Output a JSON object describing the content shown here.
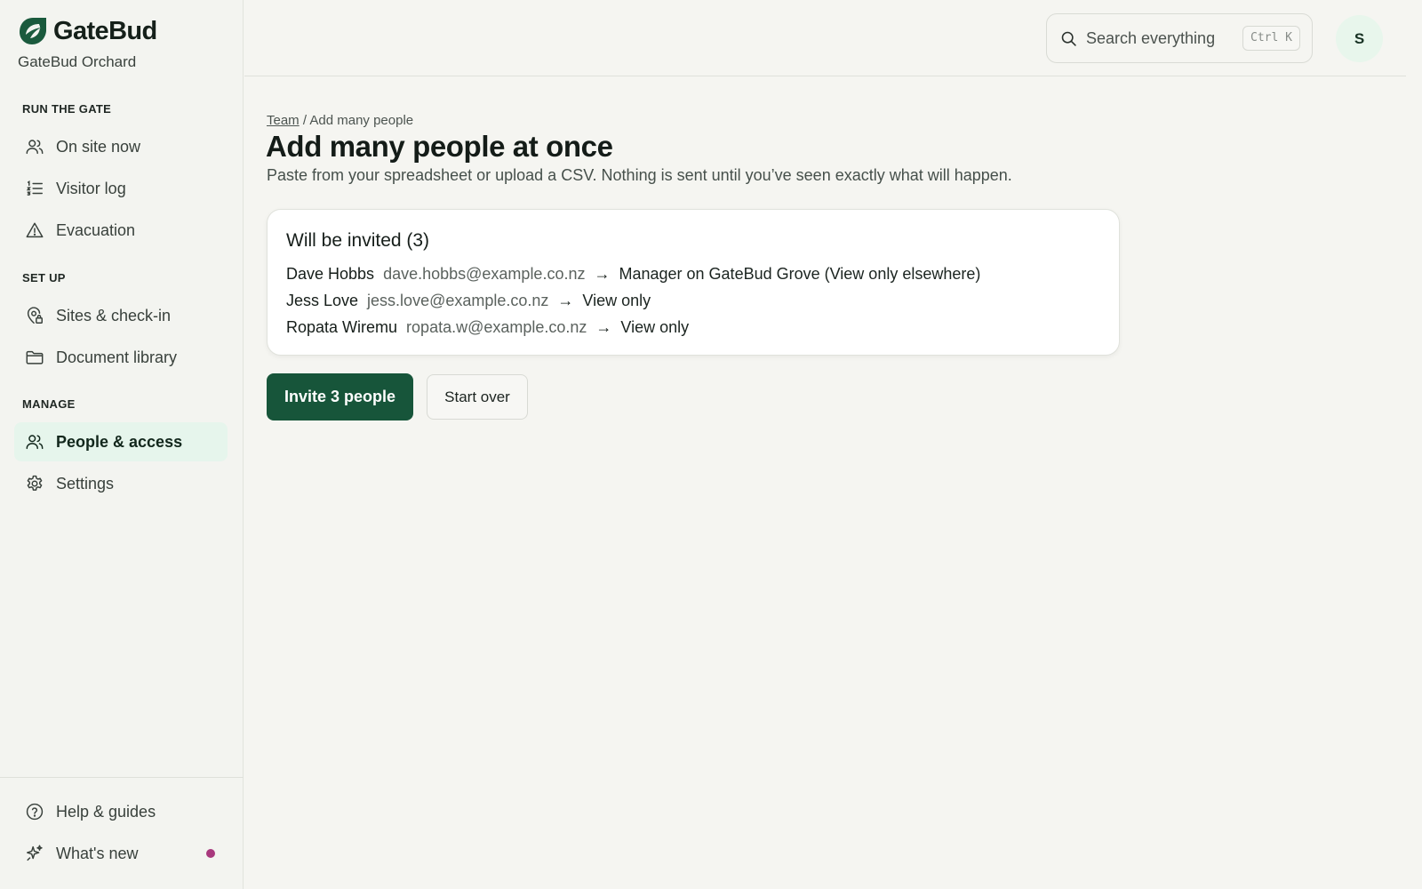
{
  "brand": {
    "name": "GateBud",
    "org": "GateBud Orchard",
    "logo_icon": "leaf-g-logo-icon",
    "accent": "#17553a"
  },
  "nav": {
    "sections": [
      {
        "label": "RUN THE GATE",
        "items": [
          {
            "label": "On site now",
            "icon": "people-icon"
          },
          {
            "label": "Visitor log",
            "icon": "list-numbered-icon"
          },
          {
            "label": "Evacuation",
            "icon": "warning-triangle-icon"
          }
        ]
      },
      {
        "label": "SET UP",
        "items": [
          {
            "label": "Sites & check-in",
            "icon": "location-lock-icon"
          },
          {
            "label": "Document library",
            "icon": "folder-icon"
          }
        ]
      },
      {
        "label": "MANAGE",
        "items": [
          {
            "label": "People & access",
            "icon": "people-icon",
            "active": true
          },
          {
            "label": "Settings",
            "icon": "gear-icon"
          }
        ]
      }
    ],
    "footer": [
      {
        "label": "Help & guides",
        "icon": "help-circle-icon"
      },
      {
        "label": "What's new",
        "icon": "sparkle-icon",
        "indicator_color": "#a8387d"
      }
    ]
  },
  "topbar": {
    "search_placeholder": "Search everything",
    "shortcut": "Ctrl K",
    "avatar_initial": "S"
  },
  "page": {
    "breadcrumb": {
      "parent": "Team",
      "separator": " / ",
      "current": "Add many people"
    },
    "title": "Add many people at once",
    "subtitle": "Paste from your spreadsheet or upload a CSV. Nothing is sent until you’ve seen exactly what will happen."
  },
  "invite_card": {
    "title": "Will be invited (3)",
    "arrow": "→",
    "rows": [
      {
        "name": "Dave Hobbs",
        "email": "dave.hobbs@example.co.nz",
        "role": "Manager on GateBud Grove (View only elsewhere)"
      },
      {
        "name": "Jess Love",
        "email": "jess.love@example.co.nz",
        "role": "View only"
      },
      {
        "name": "Ropata Wiremu",
        "email": "ropata.w@example.co.nz",
        "role": "View only"
      }
    ]
  },
  "actions": {
    "primary": "Invite 3 people",
    "secondary": "Start over"
  }
}
